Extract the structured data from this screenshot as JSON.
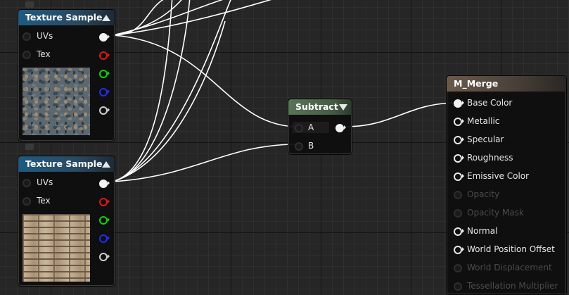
{
  "graph": {
    "colors": {
      "wire": "#ffffff",
      "grid_major": "#141414",
      "grid_minor": "#2f2f2f",
      "background": "#262626"
    }
  },
  "nodes": {
    "texture_sample_1": {
      "title": "Texture Sample",
      "inputs": [
        {
          "label": "UVs"
        },
        {
          "label": "Tex"
        }
      ],
      "outputs": [
        "white",
        "red",
        "green",
        "blue",
        "alpha"
      ],
      "preview": "pebble-texture"
    },
    "texture_sample_2": {
      "title": "Texture Sample",
      "inputs": [
        {
          "label": "UVs"
        },
        {
          "label": "Tex"
        }
      ],
      "outputs": [
        "white",
        "red",
        "green",
        "blue",
        "alpha"
      ],
      "preview": "brick-texture"
    },
    "subtract": {
      "title": "Subtract",
      "inputs": [
        {
          "label": "A"
        },
        {
          "label": "B"
        }
      ]
    },
    "material": {
      "title": "M_Merge",
      "pins": [
        {
          "label": "Base Color",
          "enabled": true
        },
        {
          "label": "Metallic",
          "enabled": true
        },
        {
          "label": "Specular",
          "enabled": true
        },
        {
          "label": "Roughness",
          "enabled": true
        },
        {
          "label": "Emissive Color",
          "enabled": true
        },
        {
          "label": "Opacity",
          "enabled": false
        },
        {
          "label": "Opacity Mask",
          "enabled": false
        },
        {
          "label": "Normal",
          "enabled": true
        },
        {
          "label": "World Position Offset",
          "enabled": true
        },
        {
          "label": "World Displacement",
          "enabled": false
        },
        {
          "label": "Tessellation Multiplier",
          "enabled": false
        }
      ]
    }
  }
}
